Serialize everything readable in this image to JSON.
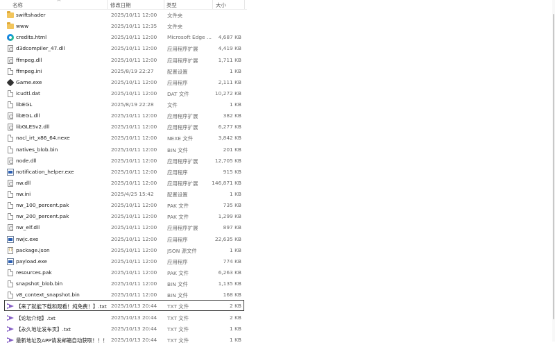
{
  "columns": {
    "name": "名称",
    "modified": "修改日期",
    "type": "类型",
    "size": "大小"
  },
  "sort_indicator": "^",
  "files": [
    {
      "name": "swiftshader",
      "date": "2025/10/11 12:00",
      "type": "文件夹",
      "size": "",
      "icon": "folder-icon"
    },
    {
      "name": "www",
      "date": "2025/10/11 12:35",
      "type": "文件夹",
      "size": "",
      "icon": "folder-icon"
    },
    {
      "name": "credits.html",
      "date": "2025/10/11 12:00",
      "type": "Microsoft Edge ...",
      "size": "4,687 KB",
      "icon": "edge-icon"
    },
    {
      "name": "d3dcompiler_47.dll",
      "date": "2025/10/11 12:00",
      "type": "应用程序扩展",
      "size": "4,419 KB",
      "icon": "dll-icon"
    },
    {
      "name": "ffmpeg.dll",
      "date": "2025/10/11 12:00",
      "type": "应用程序扩展",
      "size": "1,711 KB",
      "icon": "dll-icon"
    },
    {
      "name": "ffmpeg.ini",
      "date": "2025/8/19 22:27",
      "type": "配置设置",
      "size": "1 KB",
      "icon": "ini-file-icon"
    },
    {
      "name": "Game.exe",
      "date": "2025/10/11 12:00",
      "type": "应用程序",
      "size": "2,111 KB",
      "icon": "game-icon"
    },
    {
      "name": "icudtl.dat",
      "date": "2025/10/11 12:00",
      "type": "DAT 文件",
      "size": "10,272 KB",
      "icon": "file-icon"
    },
    {
      "name": "libEGL",
      "date": "2025/8/19 22:28",
      "type": "文件",
      "size": "1 KB",
      "icon": "file-icon"
    },
    {
      "name": "libEGL.dll",
      "date": "2025/10/11 12:00",
      "type": "应用程序扩展",
      "size": "382 KB",
      "icon": "dll-icon"
    },
    {
      "name": "libGLESv2.dll",
      "date": "2025/10/11 12:00",
      "type": "应用程序扩展",
      "size": "6,277 KB",
      "icon": "dll-icon"
    },
    {
      "name": "nacl_irt_x86_64.nexe",
      "date": "2025/10/11 12:00",
      "type": "NEXE 文件",
      "size": "3,842 KB",
      "icon": "file-icon"
    },
    {
      "name": "natives_blob.bin",
      "date": "2025/10/11 12:00",
      "type": "BIN 文件",
      "size": "201 KB",
      "icon": "file-icon"
    },
    {
      "name": "node.dll",
      "date": "2025/10/11 12:00",
      "type": "应用程序扩展",
      "size": "12,705 KB",
      "icon": "dll-icon"
    },
    {
      "name": "notification_helper.exe",
      "date": "2025/10/11 12:00",
      "type": "应用程序",
      "size": "915 KB",
      "icon": "exe-icon"
    },
    {
      "name": "nw.dll",
      "date": "2025/10/11 12:00",
      "type": "应用程序扩展",
      "size": "146,871 KB",
      "icon": "dll-icon"
    },
    {
      "name": "nw.ini",
      "date": "2025/4/25 15:42",
      "type": "配置设置",
      "size": "1 KB",
      "icon": "ini-file-icon"
    },
    {
      "name": "nw_100_percent.pak",
      "date": "2025/10/11 12:00",
      "type": "PAK 文件",
      "size": "735 KB",
      "icon": "file-icon"
    },
    {
      "name": "nw_200_percent.pak",
      "date": "2025/10/11 12:00",
      "type": "PAK 文件",
      "size": "1,299 KB",
      "icon": "file-icon"
    },
    {
      "name": "nw_elf.dll",
      "date": "2025/10/11 12:00",
      "type": "应用程序扩展",
      "size": "897 KB",
      "icon": "dll-icon"
    },
    {
      "name": "nwjc.exe",
      "date": "2025/10/11 12:00",
      "type": "应用程序",
      "size": "22,635 KB",
      "icon": "exe-icon"
    },
    {
      "name": "package.json",
      "date": "2025/10/11 12:00",
      "type": "JSON 源文件",
      "size": "1 KB",
      "icon": "json-icon"
    },
    {
      "name": "payload.exe",
      "date": "2025/10/11 12:00",
      "type": "应用程序",
      "size": "774 KB",
      "icon": "exe-icon"
    },
    {
      "name": "resources.pak",
      "date": "2025/10/11 12:00",
      "type": "PAK 文件",
      "size": "6,263 KB",
      "icon": "file-icon"
    },
    {
      "name": "snapshot_blob.bin",
      "date": "2025/10/11 12:00",
      "type": "BIN 文件",
      "size": "1,135 KB",
      "icon": "file-icon"
    },
    {
      "name": "v8_context_snapshot.bin",
      "date": "2025/10/11 12:00",
      "type": "BIN 文件",
      "size": "168 KB",
      "icon": "file-icon"
    },
    {
      "name": "【来了就能下载和观看！纯免费！】.txt",
      "date": "2025/10/13 20:44",
      "type": "TXT 文件",
      "size": "2 KB",
      "icon": "visual-studio-icon",
      "selected": true
    },
    {
      "name": "【论坛介绍】.txt",
      "date": "2025/10/13 20:44",
      "type": "TXT 文件",
      "size": "2 KB",
      "icon": "visual-studio-icon"
    },
    {
      "name": "【永久地址发布页】.txt",
      "date": "2025/10/13 20:44",
      "type": "TXT 文件",
      "size": "1 KB",
      "icon": "visual-studio-icon"
    },
    {
      "name": "最新地址及APP请发邮箱自动获取！！！ ...",
      "date": "2025/10/13 20:44",
      "type": "TXT 文件",
      "size": "1 KB",
      "icon": "visual-studio-icon"
    }
  ]
}
